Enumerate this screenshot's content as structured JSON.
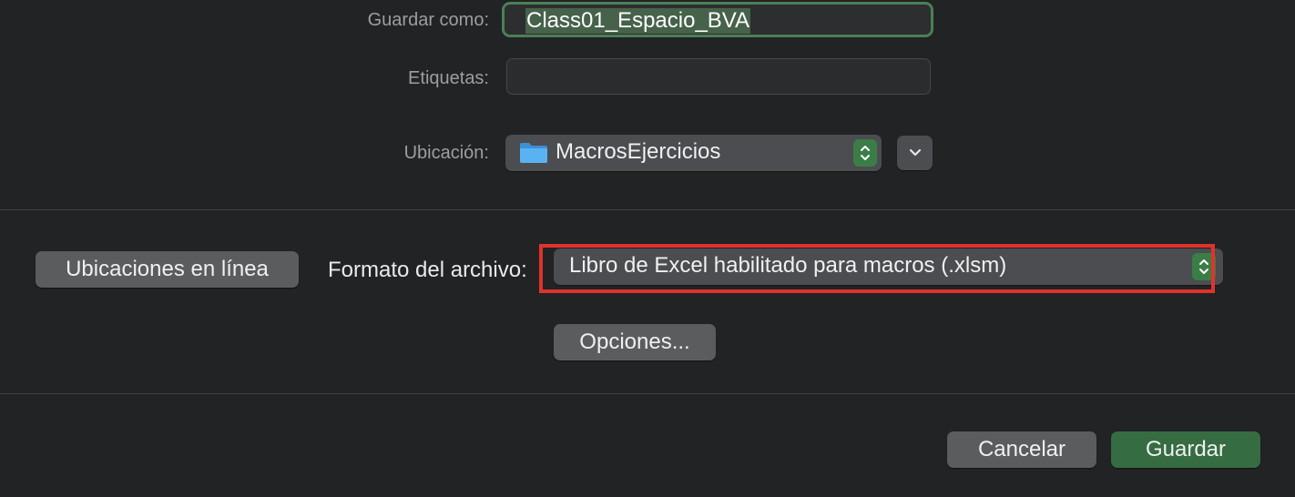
{
  "form": {
    "save_as_label": "Guardar como:",
    "save_as_value": "Class01_Espacio_BVA",
    "tags_label": "Etiquetas:",
    "tags_value": "",
    "location_label": "Ubicación:",
    "location_value": "MacrosEjercicios",
    "location_icon": "folder-icon"
  },
  "options": {
    "online_locations_label": "Ubicaciones en línea",
    "file_format_label": "Formato del archivo:",
    "file_format_value": "Libro de Excel habilitado para macros (.xlsm)",
    "options_button_label": "Opciones..."
  },
  "footer": {
    "cancel_label": "Cancelar",
    "save_label": "Guardar"
  },
  "colors": {
    "background": "#212325",
    "accent_green": "#356c41",
    "highlight_red": "#e0332b"
  }
}
